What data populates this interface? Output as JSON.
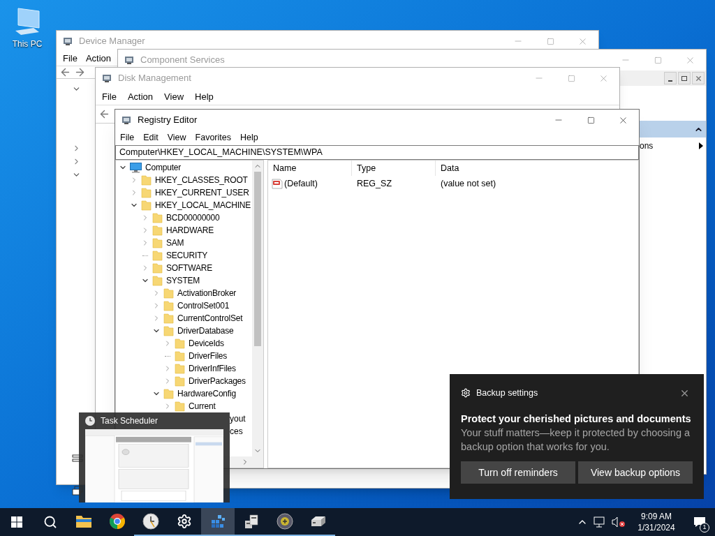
{
  "desktop_icons": [
    {
      "label": "This PC"
    }
  ],
  "device_manager": {
    "title": "Device Manager",
    "active": false,
    "menu": [
      "File",
      "Action"
    ]
  },
  "component_services": {
    "title": "Component Services",
    "active": false,
    "actions_fragment": "ons"
  },
  "disk_management": {
    "title": "Disk Management",
    "active": false,
    "menu": [
      "File",
      "Action",
      "View",
      "Help"
    ]
  },
  "registry_editor": {
    "title": "Registry Editor",
    "active": true,
    "menu": [
      "File",
      "Edit",
      "View",
      "Favorites",
      "Help"
    ],
    "address": "Computer\\HKEY_LOCAL_MACHINE\\SYSTEM\\WPA",
    "tree": [
      {
        "label": "Computer",
        "kind": "computer",
        "expanded": true,
        "children": [
          {
            "label": "HKEY_CLASSES_ROOT",
            "kind": "folder",
            "expanded": false
          },
          {
            "label": "HKEY_CURRENT_USER",
            "kind": "folder",
            "expanded": false
          },
          {
            "label": "HKEY_LOCAL_MACHINE",
            "kind": "folder",
            "expanded": true,
            "children": [
              {
                "label": "BCD00000000",
                "kind": "folder",
                "expanded": false
              },
              {
                "label": "HARDWARE",
                "kind": "folder",
                "expanded": false
              },
              {
                "label": "SAM",
                "kind": "folder",
                "expanded": false
              },
              {
                "label": "SECURITY",
                "kind": "folder"
              },
              {
                "label": "SOFTWARE",
                "kind": "folder",
                "expanded": false
              },
              {
                "label": "SYSTEM",
                "kind": "folder",
                "expanded": true,
                "children": [
                  {
                    "label": "ActivationBroker",
                    "kind": "folder",
                    "expanded": false
                  },
                  {
                    "label": "ControlSet001",
                    "kind": "folder",
                    "expanded": false
                  },
                  {
                    "label": "CurrentControlSet",
                    "kind": "folder",
                    "expanded": false
                  },
                  {
                    "label": "DriverDatabase",
                    "kind": "folder",
                    "expanded": true,
                    "children": [
                      {
                        "label": "DeviceIds",
                        "kind": "folder",
                        "expanded": false
                      },
                      {
                        "label": "DriverFiles",
                        "kind": "folder"
                      },
                      {
                        "label": "DriverInfFiles",
                        "kind": "folder",
                        "expanded": false
                      },
                      {
                        "label": "DriverPackages",
                        "kind": "folder",
                        "expanded": false
                      }
                    ]
                  },
                  {
                    "label": "HardwareConfig",
                    "kind": "folder",
                    "expanded": true,
                    "children": [
                      {
                        "label": "Current",
                        "kind": "folder",
                        "expanded": false
                      },
                      {
                        "label": "yout",
                        "kind": "fragment"
                      },
                      {
                        "label": "ces",
                        "kind": "fragment"
                      }
                    ]
                  }
                ]
              }
            ]
          }
        ]
      }
    ],
    "columns": [
      "Name",
      "Type",
      "Data"
    ],
    "values": [
      {
        "name": "(Default)",
        "type": "REG_SZ",
        "data": "(value not set)"
      }
    ]
  },
  "task_preview": {
    "title": "Task Scheduler"
  },
  "notification": {
    "app": "Backup settings",
    "heading": "Protect your cherished pictures and documents",
    "body": "Your stuff matters—keep it protected by choosing a backup option that works for you.",
    "buttons": [
      "Turn off reminders",
      "View backup options"
    ]
  },
  "taskbar": {
    "apps": [
      {
        "kind": "folder",
        "running": false,
        "selected": false
      },
      {
        "kind": "browser",
        "running": false,
        "selected": false
      },
      {
        "kind": "clock",
        "running": true,
        "selected": false
      },
      {
        "kind": "gear",
        "running": true,
        "selected": false
      },
      {
        "kind": "cubes",
        "running": true,
        "selected": true
      },
      {
        "kind": "tower",
        "running": true,
        "selected": false
      },
      {
        "kind": "globe",
        "running": true,
        "selected": false
      },
      {
        "kind": "drive",
        "running": true,
        "selected": false
      }
    ],
    "time": "9:09 AM",
    "date": "1/31/2024",
    "notification_count": "1"
  }
}
